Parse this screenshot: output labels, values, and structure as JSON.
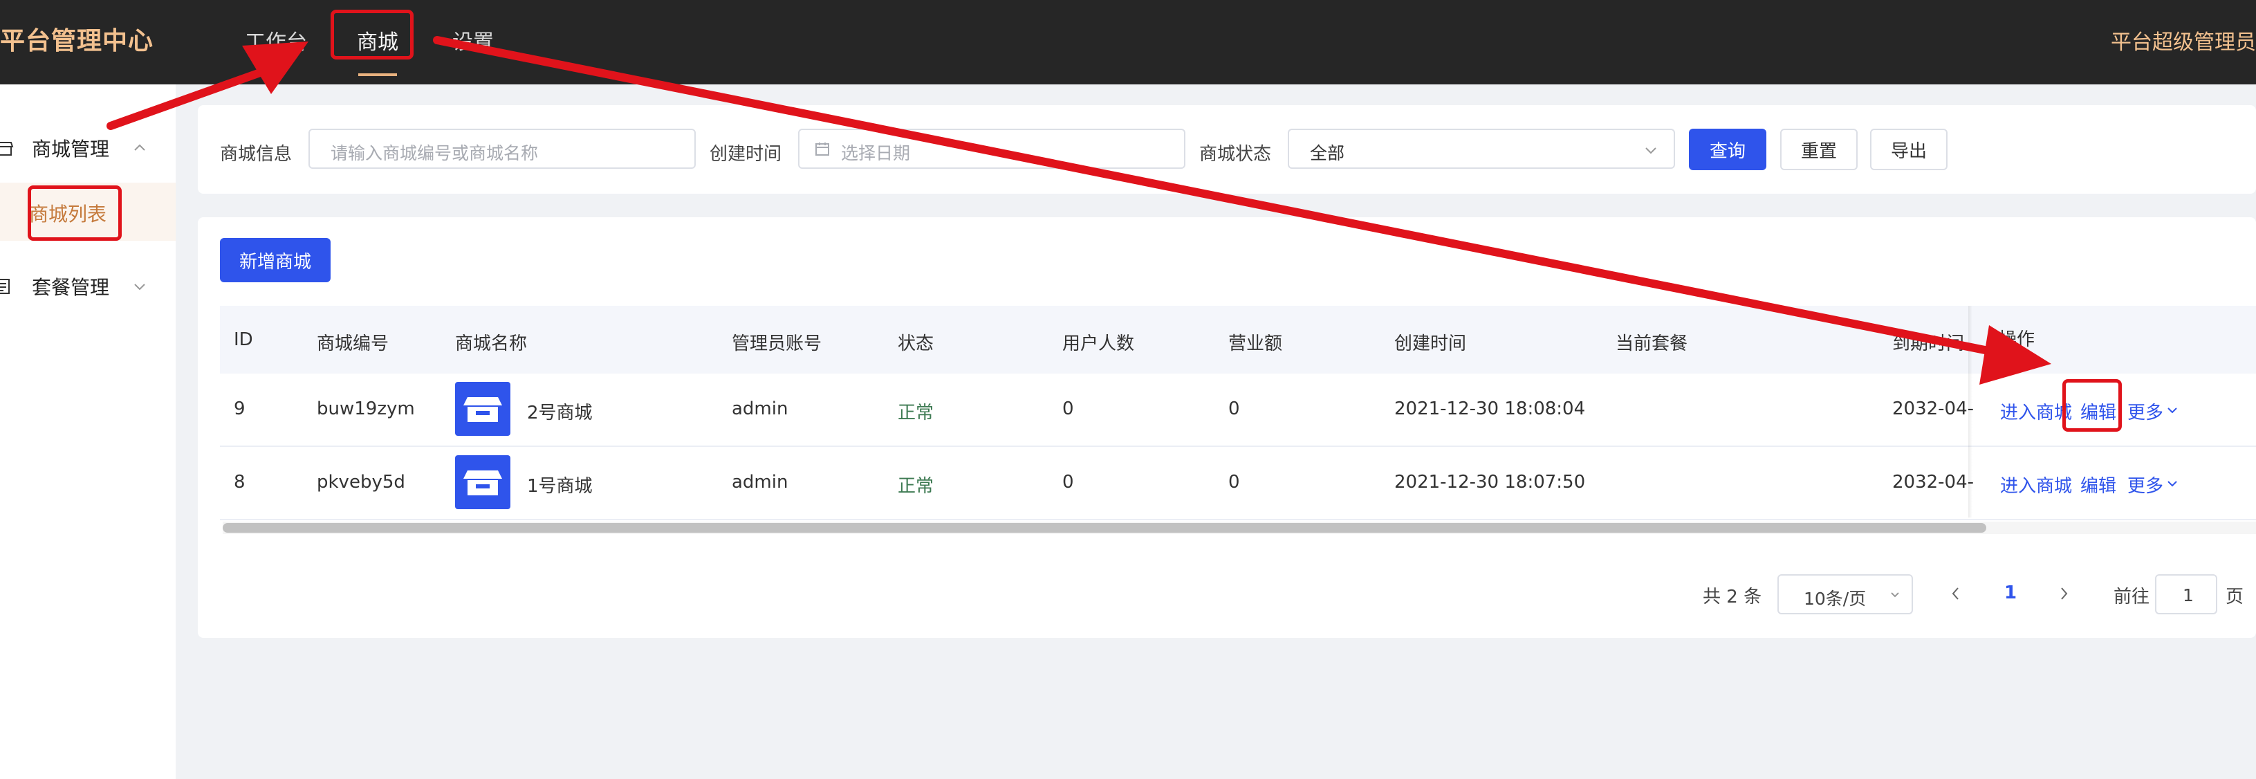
{
  "header": {
    "brand": "平台管理中心",
    "nav": [
      {
        "label": "工作台"
      },
      {
        "label": "商城"
      },
      {
        "label": "设置"
      }
    ],
    "user": "平台超级管理员"
  },
  "sidebar": {
    "groups": [
      {
        "label": "商城管理",
        "items": [
          {
            "label": "商城列表"
          }
        ]
      },
      {
        "label": "套餐管理",
        "items": []
      }
    ]
  },
  "search": {
    "shop_info_label": "商城信息",
    "shop_info_placeholder": "请输入商城编号或商城名称",
    "created_label": "创建时间",
    "created_placeholder": "选择日期",
    "status_label": "商城状态",
    "status_value": "全部",
    "query_btn": "查询",
    "reset_btn": "重置",
    "export_btn": "导出"
  },
  "table": {
    "add_btn": "新增商城",
    "columns": [
      "ID",
      "商城编号",
      "商城名称",
      "管理员账号",
      "状态",
      "用户人数",
      "营业额",
      "创建时间",
      "当前套餐",
      "到期时间",
      "操作"
    ],
    "rows": [
      {
        "id": "9",
        "code": "buw19zym",
        "name": "2号商城",
        "admin": "admin",
        "status": "正常",
        "users": "0",
        "revenue": "0",
        "created": "2021-12-30 18:08:04",
        "plan": "",
        "expire": "2032-04-",
        "op_enter": "进入商城",
        "op_edit": "编辑",
        "op_more": "更多"
      },
      {
        "id": "8",
        "code": "pkveby5d",
        "name": "1号商城",
        "admin": "admin",
        "status": "正常",
        "users": "0",
        "revenue": "0",
        "created": "2021-12-30 18:07:50",
        "plan": "",
        "expire": "2032-04-",
        "op_enter": "进入商城",
        "op_edit": "编辑",
        "op_more": "更多"
      }
    ]
  },
  "pagination": {
    "total_text": "共 2 条",
    "page_size": "10条/页",
    "current_page": "1",
    "goto_label": "前往",
    "goto_value": "1",
    "page_suffix": "页"
  },
  "colors": {
    "primary": "#2f54eb",
    "brand": "#f3c18f",
    "annotation": "#e0131b",
    "status_ok": "#3d7a52"
  }
}
